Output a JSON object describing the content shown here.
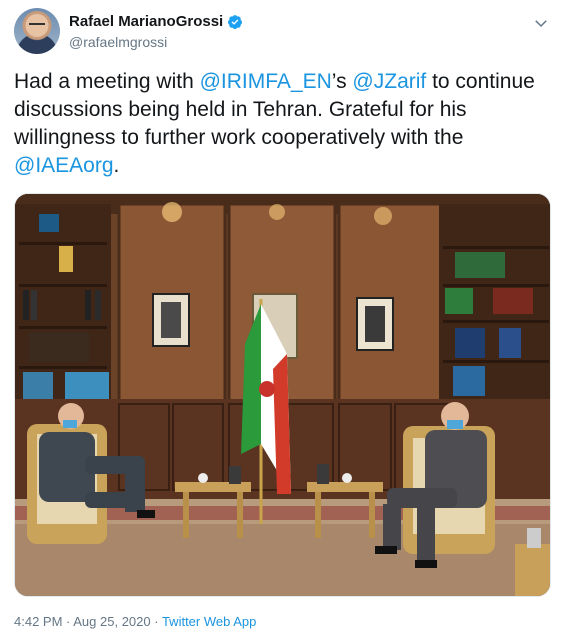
{
  "header": {
    "display_name": "Rafael MarianoGrossi",
    "handle": "@rafaelmgrossi",
    "verified": true,
    "icons": [
      "avatar",
      "verified-badge-icon",
      "chevron-down-icon"
    ]
  },
  "tweet": {
    "text_parts": [
      "Had a meeting with ",
      "@IRIMFA_EN",
      "’s ",
      "@JZarif",
      " to continue discussions being held in Tehran. Grateful for his willingness to further work cooperatively with the ",
      "@IAEAorg",
      "."
    ]
  },
  "meta": {
    "time": "4:42 PM",
    "separator1": " · ",
    "date": "Aug 25, 2020",
    "separator2": " · ",
    "app": "Twitter Web App"
  },
  "colors": {
    "link": "#1b95e0",
    "secondary": "#657786",
    "verified": "#1da1f2"
  }
}
